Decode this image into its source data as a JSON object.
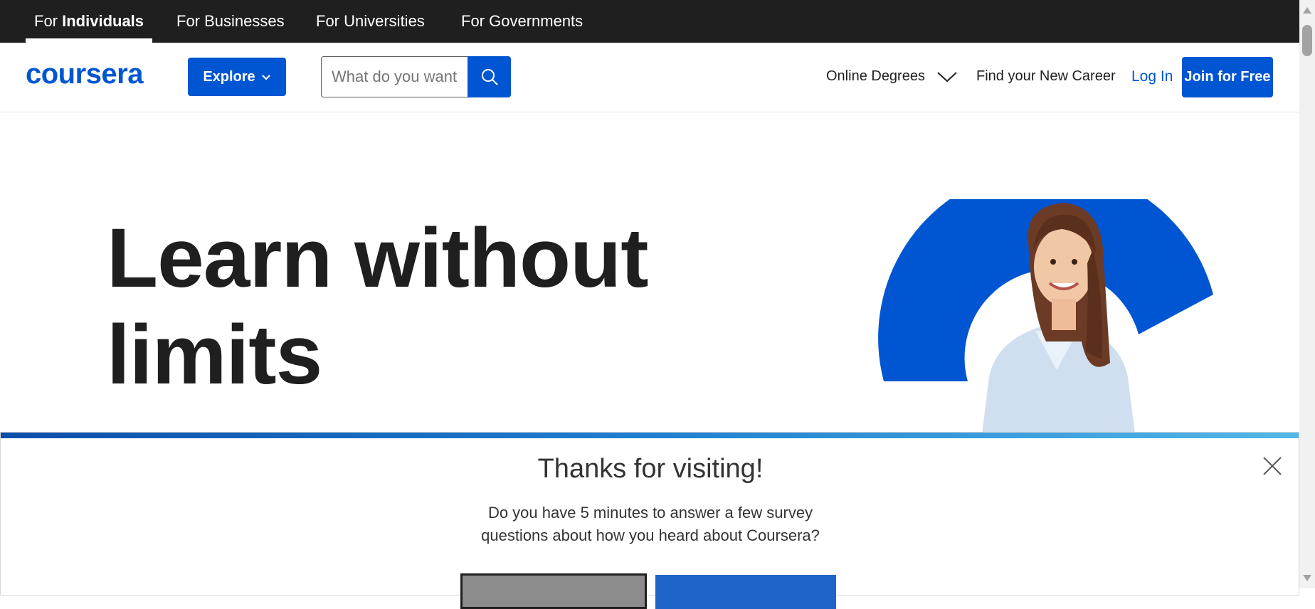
{
  "topbar": {
    "tabs": [
      {
        "prefix": "For ",
        "label": "Individuals",
        "active": true
      },
      {
        "label": "For Businesses"
      },
      {
        "label": "For Universities"
      },
      {
        "label": "For Governments"
      }
    ]
  },
  "header": {
    "logo": "coursera",
    "explore_label": "Explore",
    "search_placeholder": "What do you want",
    "online_degrees": "Online Degrees",
    "find_career": "Find your New Career",
    "login": "Log In",
    "join": "Join for Free"
  },
  "hero": {
    "title_line1": "Learn without",
    "title_line2": "limits"
  },
  "survey": {
    "title": "Thanks for visiting!",
    "text_line1": "Do you have 5 minutes to answer a few survey",
    "text_line2": "questions about how you heard about Coursera?",
    "decline_label": "",
    "accept_label": ""
  },
  "colors": {
    "brand": "#0056d2",
    "topbar": "#1f1f1f"
  },
  "icons": [
    "chevron-down-icon",
    "search-icon",
    "close-icon"
  ]
}
